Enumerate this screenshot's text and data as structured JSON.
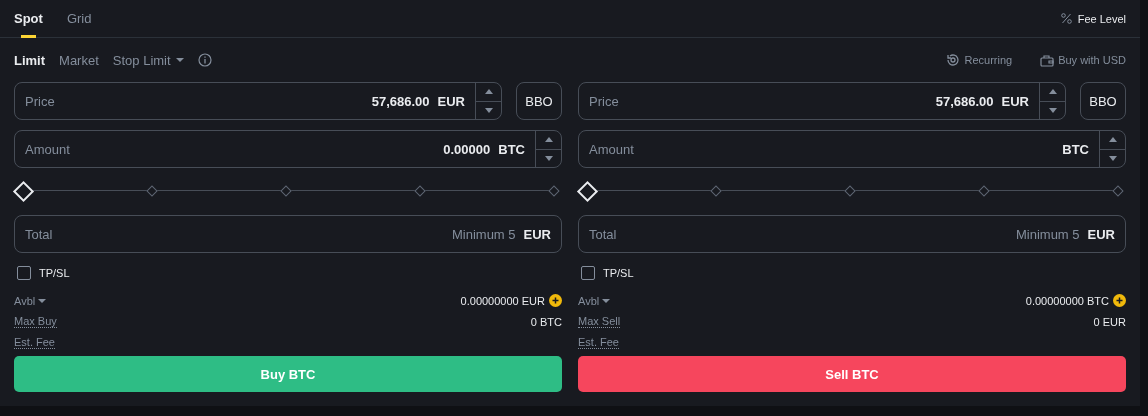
{
  "tabs": [
    {
      "label": "Spot",
      "selected": true
    },
    {
      "label": "Grid",
      "selected": false
    }
  ],
  "fee_level": "Fee Level",
  "order_types": [
    {
      "label": "Limit",
      "selected": true,
      "kind": "plain"
    },
    {
      "label": "Market",
      "selected": false,
      "kind": "plain"
    },
    {
      "label": "Stop Limit",
      "selected": false,
      "kind": "dropdown"
    }
  ],
  "links": [
    {
      "label": "Recurring",
      "kind": "recurring"
    },
    {
      "label": "Buy with USD",
      "kind": "wallet"
    }
  ],
  "panels": [
    {
      "price": {
        "label": "Price",
        "value": "57,686.00",
        "unit": "EUR"
      },
      "bbo": "BBO",
      "amount": {
        "label": "Amount",
        "value": "0.00000",
        "unit": "BTC"
      },
      "slider": {
        "level": 0
      },
      "total": {
        "label": "Total",
        "placeholder": "Minimum 5",
        "unit": "EUR"
      },
      "tpsl": {
        "label": "TP/SL",
        "checked": false
      },
      "avbl": {
        "label": "Avbl",
        "value": "0.00000000 EUR"
      },
      "max": {
        "label": "Max Buy",
        "value": "0 BTC"
      },
      "fee": {
        "label": "Est. Fee"
      },
      "action": {
        "label": "Buy BTC",
        "kind": "buy"
      }
    },
    {
      "price": {
        "label": "Price",
        "value": "57,686.00",
        "unit": "EUR"
      },
      "bbo": "BBO",
      "amount": {
        "label": "Amount",
        "unit": "BTC"
      },
      "slider": {
        "level": 0
      },
      "total": {
        "label": "Total",
        "placeholder": "Minimum 5",
        "unit": "EUR"
      },
      "tpsl": {
        "label": "TP/SL",
        "checked": false
      },
      "avbl": {
        "label": "Avbl",
        "value": "0.00000000 BTC"
      },
      "max": {
        "label": "Max Sell",
        "value": "0 EUR"
      },
      "fee": {
        "label": "Est. Fee"
      },
      "action": {
        "label": "Sell BTC",
        "kind": "sell"
      }
    }
  ]
}
